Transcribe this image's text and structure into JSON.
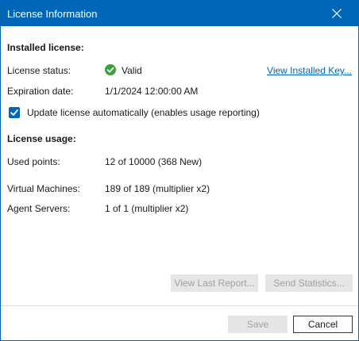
{
  "window": {
    "title": "License Information"
  },
  "installed": {
    "heading": "Installed license:",
    "status_label": "License status:",
    "status_value": "Valid",
    "view_key_link": "View Installed Key...",
    "expiration_label": "Expiration date:",
    "expiration_value": "1/1/2024 12:00:00 AM",
    "auto_update_label": "Update license automatically (enables usage reporting)",
    "auto_update_checked": true
  },
  "usage": {
    "heading": "License usage:",
    "used_points_label": "Used points:",
    "used_points_value": "12 of 10000 (368 New)",
    "vms_label": "Virtual Machines:",
    "vms_value": "189 of 189 (multiplier x2)",
    "agents_label": "Agent Servers:",
    "agents_value": "1 of 1 (multiplier x2)"
  },
  "buttons": {
    "view_report": "View Last Report...",
    "send_stats": "Send Statistics...",
    "save": "Save",
    "cancel": "Cancel"
  },
  "colors": {
    "accent": "#0067b8",
    "valid": "#3aa23a"
  },
  "icons": {
    "close": "close-icon",
    "status": "check-circle-icon",
    "checkbox": "checkmark-icon"
  }
}
